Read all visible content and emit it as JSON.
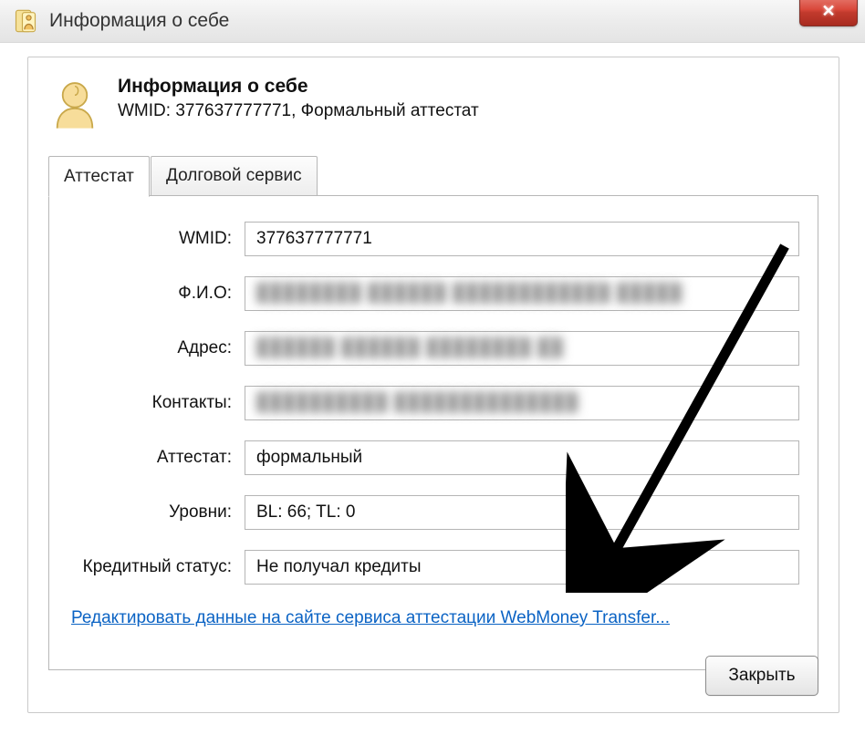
{
  "window": {
    "title": "Информация о себе"
  },
  "header": {
    "title": "Информация о себе",
    "subtitle": "WMID: 377637777771, Формальный аттестат"
  },
  "tabs": {
    "tab1": "Аттестат",
    "tab2": "Долговой сервис"
  },
  "fields": {
    "wmid": {
      "label": "WMID:",
      "value": "377637777771"
    },
    "fio": {
      "label": "Ф.И.О:",
      "value": "████████ ██████ ████████████ █████"
    },
    "address": {
      "label": "Адрес:",
      "value": "██████ ██████ ████████ ██"
    },
    "contacts": {
      "label": "Контакты:",
      "value": "██████████ ██████████████"
    },
    "certificate": {
      "label": "Аттестат:",
      "value": "формальный"
    },
    "levels": {
      "label": "Уровни:",
      "value": "BL: 66; TL: 0"
    },
    "credit": {
      "label": "Кредитный статус:",
      "value": "Не получал кредиты"
    }
  },
  "link": "Редактировать данные на сайте сервиса аттестации WebMoney Transfer...",
  "buttons": {
    "close": "Закрыть"
  }
}
